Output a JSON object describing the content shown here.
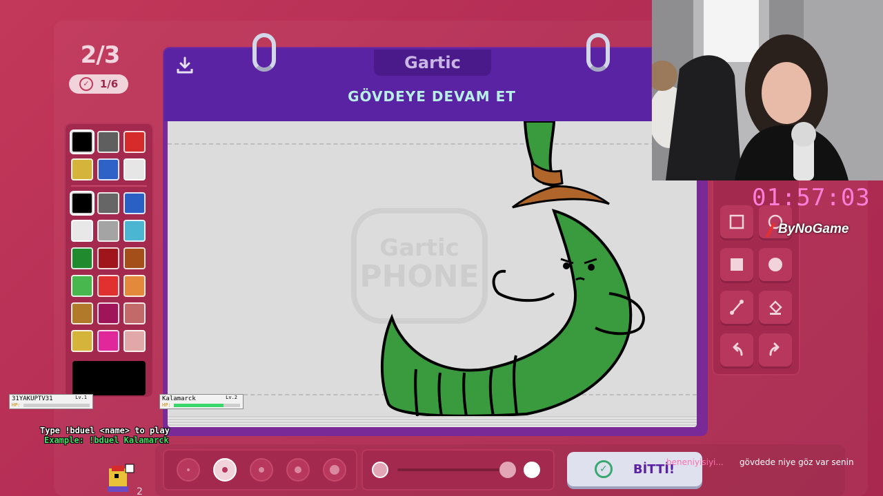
{
  "round": {
    "progress": "2/3",
    "done_count": "1/6"
  },
  "pad": {
    "logo": "Gartic",
    "title": "GÖVDEYE DEVAM ET",
    "watermark": "Gartic PHONE"
  },
  "palette": {
    "top": [
      "#000000",
      "#5f5f5f",
      "#d62b2b",
      "#d4b43a",
      "#2f62c7",
      "#e6e6e6"
    ],
    "main": [
      "#000000",
      "#666666",
      "#2a5fc4",
      "#e8e8e8",
      "#a4a4a4",
      "#4bb5d2",
      "#1f8a2e",
      "#a0151c",
      "#a44e1a",
      "#48b84e",
      "#e03030",
      "#e3893b",
      "#b07a2a",
      "#a0155a",
      "#c26a6a",
      "#d4b43a",
      "#e0289a",
      "#e0a8a8"
    ],
    "selected": "#000000"
  },
  "webcam": {
    "label": "streamer-webcam"
  },
  "overlay": {
    "timer": "01:57:03",
    "brand": "ByNoGame"
  },
  "players": [
    {
      "name": "31YAKUPTV31",
      "level": "Lv.1",
      "hp_label": "HP:",
      "hp": 0.0
    },
    {
      "name": "Kalamarck",
      "level": "Lv.2",
      "hp_label": "HP:",
      "hp": 0.75
    }
  ],
  "duel": {
    "line1": "Type !bduel <name> to play",
    "line2": "Example: !bduel Kalamarck"
  },
  "toolbar": {
    "done_label": "BİTTİ!"
  },
  "chat": {
    "user": "beneniyisiyi...",
    "message": "gövdede niye göz var senin"
  },
  "mascot_count": "2"
}
